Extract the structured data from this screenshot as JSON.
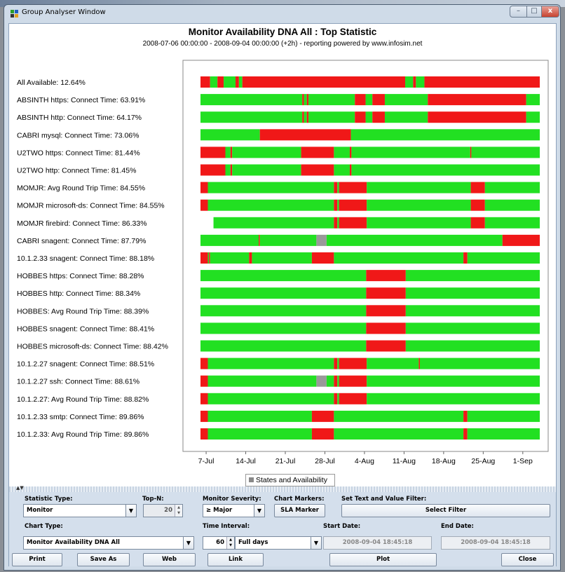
{
  "window": {
    "title": "Group Analyser Window",
    "min": "–",
    "max": "□",
    "close": "x"
  },
  "chart_title": "Monitor Availability DNA All : Top Statistic",
  "chart_subtitle": "2008-07-06 00:00:00 - 2008-09-04 00:00:00 (+2h) - reporting powered by www.infosim.net",
  "colors": {
    "available": "#22e022",
    "unavailable": "#f01818",
    "unknown": "#999999"
  },
  "chart_data": {
    "type": "bar",
    "subtype": "horizontal state timeline",
    "x_axis": {
      "type": "date",
      "range": [
        "2008-07-06",
        "2008-09-04"
      ],
      "tick_labels": [
        "7-Jul",
        "14-Jul",
        "21-Jul",
        "28-Jul",
        "4-Aug",
        "11-Aug",
        "18-Aug",
        "25-Aug",
        "1-Sep"
      ],
      "tick_days": [
        1,
        8,
        15,
        22,
        29,
        36,
        43,
        50,
        57
      ],
      "total_days": 60
    },
    "legend": "States and Availability",
    "series": [
      {
        "label": "All Available: 12.64%",
        "start": 0.0,
        "segments": [
          [
            0.0,
            1.7,
            "r"
          ],
          [
            1.7,
            3.0,
            "g"
          ],
          [
            3.0,
            4.1,
            "r"
          ],
          [
            4.1,
            6.2,
            "g"
          ],
          [
            6.2,
            6.8,
            "r"
          ],
          [
            6.8,
            7.4,
            "g"
          ],
          [
            7.4,
            36.2,
            "r"
          ],
          [
            36.2,
            37.6,
            "g"
          ],
          [
            37.6,
            38.1,
            "r"
          ],
          [
            38.1,
            39.6,
            "g"
          ],
          [
            39.6,
            60.0,
            "r"
          ]
        ]
      },
      {
        "label": "ABSINTH https: Connect Time: 63.91%",
        "start": 0.0,
        "segments": [
          [
            0.0,
            18.0,
            "g"
          ],
          [
            18.0,
            18.3,
            "r"
          ],
          [
            18.3,
            18.8,
            "g"
          ],
          [
            18.8,
            19.1,
            "r"
          ],
          [
            19.1,
            27.3,
            "g"
          ],
          [
            27.3,
            29.2,
            "r"
          ],
          [
            29.2,
            30.4,
            "g"
          ],
          [
            30.4,
            32.6,
            "r"
          ],
          [
            32.6,
            40.2,
            "g"
          ],
          [
            40.2,
            57.6,
            "r"
          ],
          [
            57.6,
            60.0,
            "g"
          ]
        ]
      },
      {
        "label": "ABSINTH http: Connect Time: 64.17%",
        "start": 0.0,
        "segments": [
          [
            0.0,
            18.0,
            "g"
          ],
          [
            18.0,
            18.3,
            "r"
          ],
          [
            18.3,
            18.8,
            "g"
          ],
          [
            18.8,
            19.1,
            "r"
          ],
          [
            19.1,
            27.3,
            "g"
          ],
          [
            27.3,
            29.2,
            "r"
          ],
          [
            29.2,
            30.4,
            "g"
          ],
          [
            30.4,
            32.6,
            "r"
          ],
          [
            32.6,
            40.2,
            "g"
          ],
          [
            40.2,
            57.6,
            "r"
          ],
          [
            57.6,
            60.0,
            "g"
          ]
        ]
      },
      {
        "label": "CABRI mysql: Connect Time: 73.06%",
        "start": 0.0,
        "segments": [
          [
            0.0,
            10.5,
            "g"
          ],
          [
            10.5,
            26.6,
            "r"
          ],
          [
            26.6,
            60.0,
            "g"
          ]
        ]
      },
      {
        "label": "U2TWO https: Connect Time: 81.44%",
        "start": 0.0,
        "segments": [
          [
            0.0,
            4.4,
            "r"
          ],
          [
            4.4,
            5.3,
            "g"
          ],
          [
            5.3,
            5.6,
            "r"
          ],
          [
            5.6,
            17.8,
            "g"
          ],
          [
            17.8,
            23.6,
            "r"
          ],
          [
            23.6,
            26.4,
            "g"
          ],
          [
            26.4,
            26.7,
            "r"
          ],
          [
            26.7,
            47.7,
            "g"
          ],
          [
            47.7,
            47.9,
            "r"
          ],
          [
            47.9,
            60.0,
            "g"
          ]
        ]
      },
      {
        "label": "U2TWO http: Connect Time: 81.45%",
        "start": 0.0,
        "segments": [
          [
            0.0,
            4.4,
            "r"
          ],
          [
            4.4,
            5.3,
            "g"
          ],
          [
            5.3,
            5.6,
            "r"
          ],
          [
            5.6,
            17.8,
            "g"
          ],
          [
            17.8,
            23.6,
            "r"
          ],
          [
            23.6,
            26.4,
            "g"
          ],
          [
            26.4,
            26.7,
            "r"
          ],
          [
            26.7,
            60.0,
            "g"
          ]
        ]
      },
      {
        "label": "MOMJR: Avg Round Trip Time: 84.55%",
        "start": 0.0,
        "segments": [
          [
            0.0,
            1.3,
            "r"
          ],
          [
            1.3,
            23.6,
            "g"
          ],
          [
            23.6,
            24.2,
            "r"
          ],
          [
            24.2,
            24.5,
            "g"
          ],
          [
            24.5,
            29.4,
            "r"
          ],
          [
            29.4,
            47.8,
            "g"
          ],
          [
            47.8,
            50.3,
            "r"
          ],
          [
            50.3,
            60.0,
            "g"
          ]
        ]
      },
      {
        "label": "MOMJR microsoft-ds: Connect Time: 84.55%",
        "start": 0.0,
        "segments": [
          [
            0.0,
            1.3,
            "r"
          ],
          [
            1.3,
            23.6,
            "g"
          ],
          [
            23.6,
            24.2,
            "r"
          ],
          [
            24.2,
            24.5,
            "g"
          ],
          [
            24.5,
            29.4,
            "r"
          ],
          [
            29.4,
            47.8,
            "g"
          ],
          [
            47.8,
            50.3,
            "r"
          ],
          [
            50.3,
            60.0,
            "g"
          ]
        ]
      },
      {
        "label": "MOMJR firebird: Connect Time: 86.33%",
        "start": 2.3,
        "segments": [
          [
            2.3,
            23.6,
            "g"
          ],
          [
            23.6,
            24.2,
            "r"
          ],
          [
            24.2,
            24.5,
            "g"
          ],
          [
            24.5,
            29.4,
            "r"
          ],
          [
            29.4,
            47.8,
            "g"
          ],
          [
            47.8,
            50.3,
            "r"
          ],
          [
            50.3,
            60.0,
            "g"
          ]
        ]
      },
      {
        "label": "CABRI snagent: Connect Time: 87.79%",
        "start": 0.0,
        "segments": [
          [
            0.0,
            10.3,
            "g"
          ],
          [
            10.3,
            10.5,
            "r"
          ],
          [
            10.5,
            20.5,
            "g"
          ],
          [
            20.5,
            22.3,
            "u"
          ],
          [
            22.3,
            53.4,
            "g"
          ],
          [
            53.4,
            60.0,
            "r"
          ]
        ]
      },
      {
        "label": "10.1.2.33 snagent: Connect Time: 88.18%",
        "start": 0.0,
        "segments": [
          [
            0.0,
            1.3,
            "r"
          ],
          [
            1.3,
            1.5,
            "g"
          ],
          [
            1.5,
            1.7,
            "r"
          ],
          [
            1.7,
            8.6,
            "g"
          ],
          [
            8.6,
            9.1,
            "r"
          ],
          [
            9.1,
            19.7,
            "g"
          ],
          [
            19.7,
            23.6,
            "r"
          ],
          [
            23.6,
            46.5,
            "g"
          ],
          [
            46.5,
            47.2,
            "r"
          ],
          [
            47.2,
            60.0,
            "g"
          ]
        ]
      },
      {
        "label": "HOBBES https: Connect Time: 88.28%",
        "start": 0.0,
        "segments": [
          [
            0.0,
            29.3,
            "g"
          ],
          [
            29.3,
            36.3,
            "r"
          ],
          [
            36.3,
            60.0,
            "g"
          ]
        ]
      },
      {
        "label": "HOBBES http: Connect Time: 88.34%",
        "start": 0.0,
        "segments": [
          [
            0.0,
            29.3,
            "g"
          ],
          [
            29.3,
            36.3,
            "r"
          ],
          [
            36.3,
            60.0,
            "g"
          ]
        ]
      },
      {
        "label": "HOBBES: Avg Round Trip Time: 88.39%",
        "start": 0.0,
        "segments": [
          [
            0.0,
            29.3,
            "g"
          ],
          [
            29.3,
            36.3,
            "r"
          ],
          [
            36.3,
            60.0,
            "g"
          ]
        ]
      },
      {
        "label": "HOBBES snagent: Connect Time: 88.41%",
        "start": 0.0,
        "segments": [
          [
            0.0,
            29.3,
            "g"
          ],
          [
            29.3,
            36.3,
            "r"
          ],
          [
            36.3,
            60.0,
            "g"
          ]
        ]
      },
      {
        "label": "HOBBES microsoft-ds: Connect Time: 88.42%",
        "start": 0.0,
        "segments": [
          [
            0.0,
            29.3,
            "g"
          ],
          [
            29.3,
            36.3,
            "r"
          ],
          [
            36.3,
            60.0,
            "g"
          ]
        ]
      },
      {
        "label": "10.1.2.27 snagent: Connect Time: 88.51%",
        "start": 0.0,
        "segments": [
          [
            0.0,
            1.3,
            "r"
          ],
          [
            1.3,
            23.6,
            "g"
          ],
          [
            23.6,
            24.2,
            "r"
          ],
          [
            24.2,
            24.5,
            "g"
          ],
          [
            24.5,
            29.4,
            "r"
          ],
          [
            29.4,
            38.6,
            "g"
          ],
          [
            38.6,
            38.8,
            "r"
          ],
          [
            38.8,
            60.0,
            "g"
          ]
        ]
      },
      {
        "label": "10.1.2.27 ssh: Connect Time: 88.61%",
        "start": 0.0,
        "segments": [
          [
            0.0,
            1.3,
            "r"
          ],
          [
            1.3,
            20.5,
            "g"
          ],
          [
            20.5,
            22.3,
            "u"
          ],
          [
            22.3,
            23.6,
            "g"
          ],
          [
            23.6,
            24.2,
            "r"
          ],
          [
            24.2,
            24.5,
            "g"
          ],
          [
            24.5,
            29.4,
            "r"
          ],
          [
            29.4,
            60.0,
            "g"
          ]
        ]
      },
      {
        "label": "10.1.2.27: Avg Round Trip Time: 88.82%",
        "start": 0.0,
        "segments": [
          [
            0.0,
            1.3,
            "r"
          ],
          [
            1.3,
            23.6,
            "g"
          ],
          [
            23.6,
            24.2,
            "r"
          ],
          [
            24.2,
            24.5,
            "g"
          ],
          [
            24.5,
            29.4,
            "r"
          ],
          [
            29.4,
            60.0,
            "g"
          ]
        ]
      },
      {
        "label": "10.1.2.33 smtp: Connect Time: 89.86%",
        "start": 0.0,
        "segments": [
          [
            0.0,
            1.3,
            "r"
          ],
          [
            1.3,
            19.7,
            "g"
          ],
          [
            19.7,
            23.6,
            "r"
          ],
          [
            23.6,
            46.5,
            "g"
          ],
          [
            46.5,
            47.2,
            "r"
          ],
          [
            47.2,
            60.0,
            "g"
          ]
        ]
      },
      {
        "label": "10.1.2.33: Avg Round Trip Time: 89.86%",
        "start": 0.0,
        "segments": [
          [
            0.0,
            1.3,
            "r"
          ],
          [
            1.3,
            19.7,
            "g"
          ],
          [
            19.7,
            23.6,
            "r"
          ],
          [
            23.6,
            46.5,
            "g"
          ],
          [
            46.5,
            47.2,
            "r"
          ],
          [
            47.2,
            60.0,
            "g"
          ]
        ]
      }
    ]
  },
  "controls": {
    "statistic_type": {
      "label": "Statistic Type:",
      "value": "Monitor"
    },
    "top_n": {
      "label": "Top-N:",
      "value": "20"
    },
    "monitor_severity": {
      "label": "Monitor Severity:",
      "value": "≥ Major"
    },
    "chart_markers": {
      "label": "Chart Markers:",
      "button": "SLA Marker"
    },
    "filter": {
      "label": "Set Text and Value Filter:",
      "button": "Select Filter"
    },
    "chart_type": {
      "label": "Chart Type:",
      "value": "Monitor Availability DNA All"
    },
    "time_interval": {
      "label": "Time Interval:",
      "value": "60",
      "unit": "Full days"
    },
    "start_date": {
      "label": "Start Date:",
      "value": "2008-09-04 18:45:18"
    },
    "end_date": {
      "label": "End Date:",
      "value": "2008-09-04 18:45:18"
    }
  },
  "buttons": {
    "print": "Print",
    "save_as": "Save As",
    "web": "Web",
    "link": "Link",
    "plot": "Plot",
    "close": "Close"
  }
}
